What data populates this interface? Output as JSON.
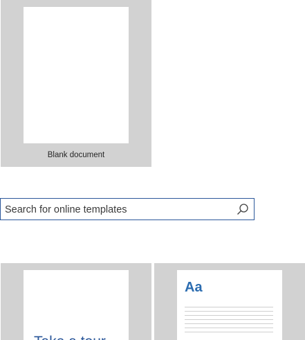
{
  "templates": {
    "blank": {
      "caption": "Blank document"
    },
    "tour": {
      "preview_text": "Take a tour"
    },
    "style": {
      "preview_text": "Aa"
    }
  },
  "search": {
    "placeholder": "Search for online templates",
    "icon": "search-icon"
  },
  "colors": {
    "tile_bg": "#d2d2d2",
    "accent": "#2b579a",
    "search_border": "#2b579a"
  }
}
